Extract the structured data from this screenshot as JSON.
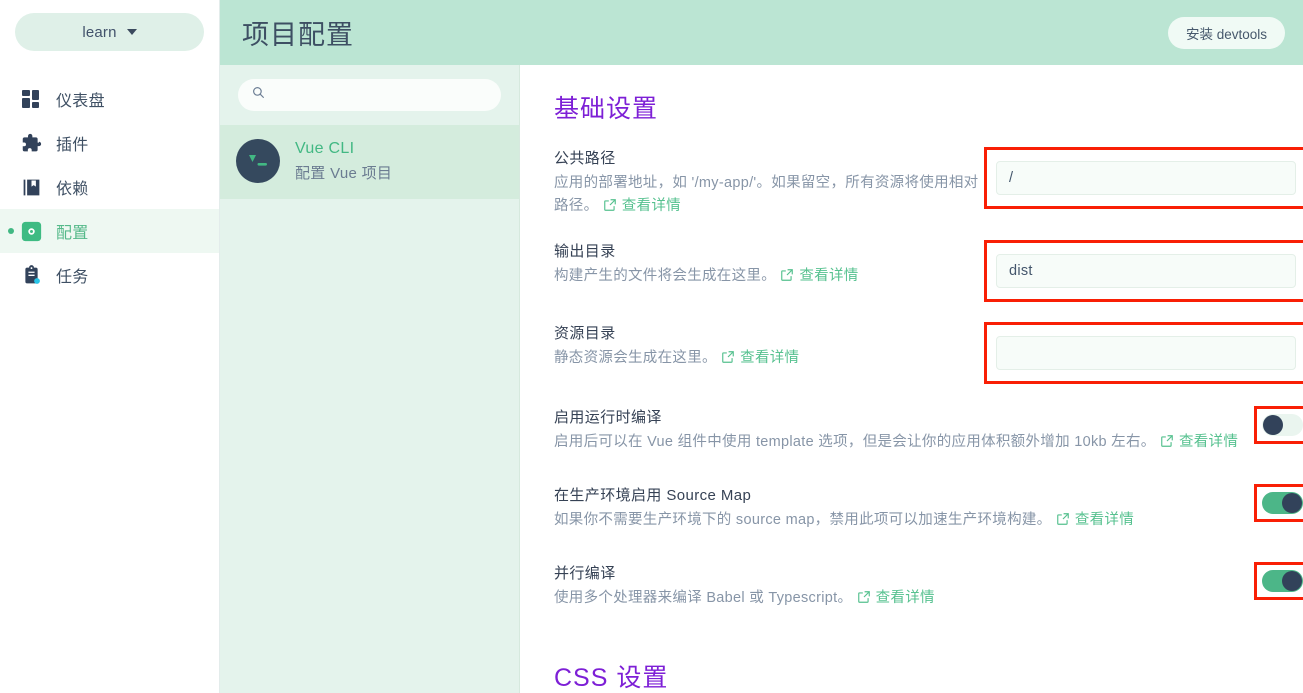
{
  "nav": {
    "project_switcher": {
      "label": "learn",
      "icon": "chevron-down-icon"
    },
    "items": [
      {
        "id": "dashboard",
        "label": "仪表盘",
        "icon": "dashboard-icon",
        "active": false
      },
      {
        "id": "plugins",
        "label": "插件",
        "icon": "puzzle-icon",
        "active": false
      },
      {
        "id": "dependencies",
        "label": "依赖",
        "icon": "book-icon",
        "active": false
      },
      {
        "id": "configuration",
        "label": "配置",
        "icon": "gear-icon",
        "active": true
      },
      {
        "id": "tasks",
        "label": "任务",
        "icon": "clipboard-icon",
        "active": false
      }
    ]
  },
  "topbar": {
    "title": "项目配置",
    "devtools_button": "安装 devtools"
  },
  "config_list": {
    "search": {
      "value": "",
      "placeholder": "",
      "icon": "search-icon"
    },
    "items": [
      {
        "id": "vue-cli",
        "name": "Vue CLI",
        "description": "配置 Vue 项目",
        "logo": "vue-cli-terminal-icon",
        "selected": true
      }
    ]
  },
  "detail": {
    "sections": [
      {
        "id": "basic",
        "title": "基础设置"
      },
      {
        "id": "css",
        "title": "CSS 设置"
      }
    ],
    "link_label": "查看详情",
    "link_icon": "external-link-icon",
    "fields": [
      {
        "id": "public-path",
        "label": "公共路径",
        "description": "应用的部署地址，如 '/my-app/'。如果留空，所有资源将使用相对路径。",
        "control": "text",
        "value": "/",
        "placeholder": "",
        "annotated": true
      },
      {
        "id": "output-dir",
        "label": "输出目录",
        "description": "构建产生的文件将会生成在这里。",
        "control": "text",
        "value": "dist",
        "placeholder": "",
        "annotated": true
      },
      {
        "id": "assets-dir",
        "label": "资源目录",
        "description": "静态资源会生成在这里。",
        "control": "text",
        "value": "",
        "placeholder": "",
        "annotated": true
      },
      {
        "id": "runtime-compiler",
        "label": "启用运行时编译",
        "description": "启用后可以在 Vue 组件中使用 template 选项，但是会让你的应用体积额外增加 10kb 左右。",
        "control": "switch",
        "value": false,
        "annotated": true
      },
      {
        "id": "production-source-map",
        "label": "在生产环境启用 Source Map",
        "description": "如果你不需要生产环境下的 source map，禁用此项可以加速生产环境构建。",
        "control": "switch",
        "value": true,
        "annotated": true
      },
      {
        "id": "parallel",
        "label": "并行编译",
        "description": "使用多个处理器来编译 Babel 或 Typescript。",
        "control": "switch",
        "value": true,
        "annotated": true
      }
    ]
  },
  "colors": {
    "brand_green": "#42b883",
    "header_mint": "#bbe5d3",
    "panel_mint": "#e4f3ec",
    "selected_mint": "#d4ecdd",
    "section_purple": "#7d1fd6",
    "dark_navy": "#35495e",
    "annotation_red": "#f91f05",
    "toggle_on": "#4cb688",
    "toggle_off": "#eaf5ef",
    "badge_cyan": "#29c5e8"
  }
}
